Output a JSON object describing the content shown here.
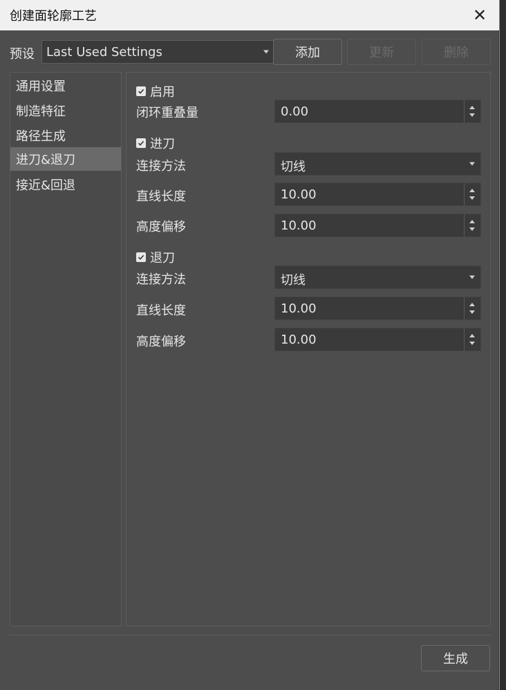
{
  "window": {
    "title": "创建面轮廓工艺",
    "close_icon": "close-icon"
  },
  "preset": {
    "label": "预设",
    "selected": "Last Used Settings",
    "add_label": "添加",
    "update_label": "更新",
    "delete_label": "删除"
  },
  "sidebar": {
    "items": [
      {
        "label": "通用设置"
      },
      {
        "label": "制造特征"
      },
      {
        "label": "路径生成"
      },
      {
        "label": "进刀&退刀",
        "active": true
      },
      {
        "label": "接近&回退"
      }
    ]
  },
  "content": {
    "enable": {
      "label": "启用",
      "checked": true
    },
    "closed_overlap": {
      "label": "闭环重叠量",
      "value": "0.00"
    },
    "lead_in": {
      "label": "进刀",
      "checked": true,
      "method_label": "连接方法",
      "method_value": "切线",
      "line_length_label": "直线长度",
      "line_length_value": "10.00",
      "height_offset_label": "高度偏移",
      "height_offset_value": "10.00"
    },
    "lead_out": {
      "label": "退刀",
      "checked": true,
      "method_label": "连接方法",
      "method_value": "切线",
      "line_length_label": "直线长度",
      "line_length_value": "10.00",
      "height_offset_label": "高度偏移",
      "height_offset_value": "10.00"
    }
  },
  "footer": {
    "generate_label": "生成"
  },
  "colors": {
    "dialog_bg": "#4d4d4d",
    "titlebar_bg": "#f0f0f0",
    "active_item_bg": "#6a6a6a",
    "field_bg": "#3a3a3a"
  }
}
